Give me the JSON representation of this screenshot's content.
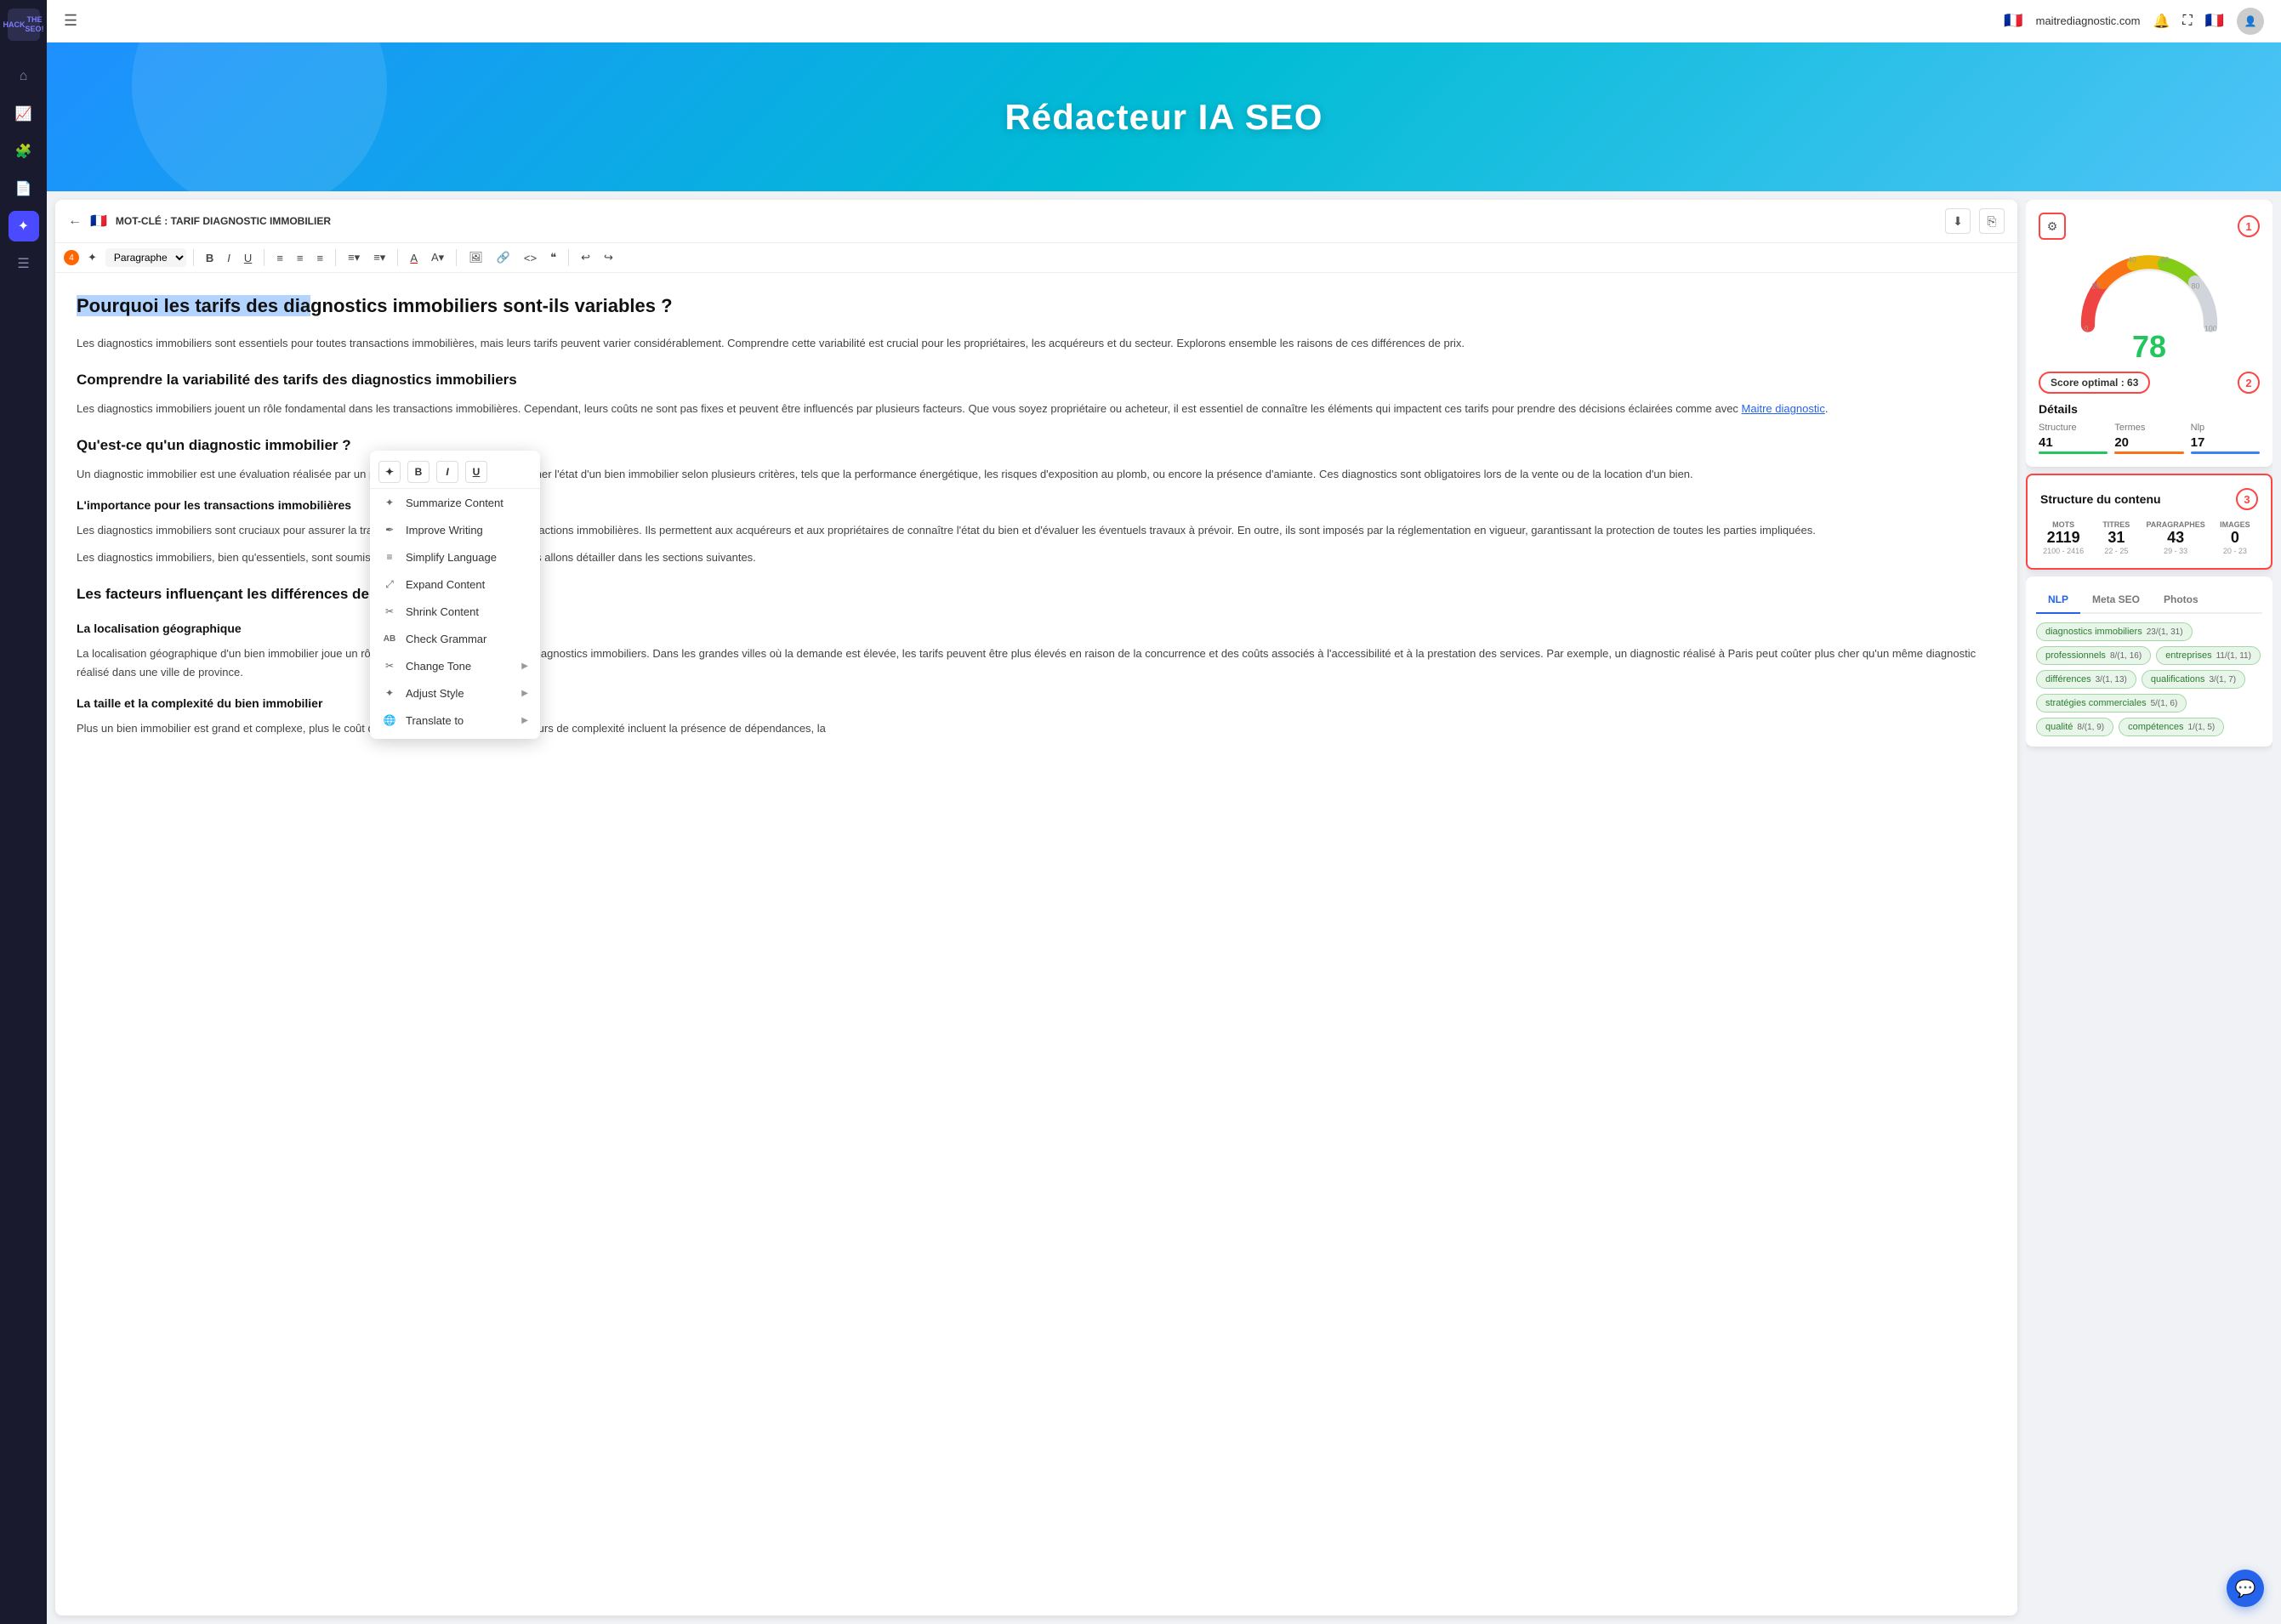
{
  "sidebar": {
    "logo_line1": "HACK",
    "logo_line2": "THE SEO!",
    "items": [
      {
        "name": "home",
        "icon": "⌂",
        "active": false
      },
      {
        "name": "analytics",
        "icon": "📈",
        "active": false
      },
      {
        "name": "puzzle",
        "icon": "🧩",
        "active": false
      },
      {
        "name": "document",
        "icon": "📄",
        "active": false
      },
      {
        "name": "star",
        "icon": "✦",
        "active": true
      },
      {
        "name": "menu2",
        "icon": "☰",
        "active": false
      }
    ]
  },
  "topbar": {
    "hamburger_icon": "☰",
    "flag": "🇫🇷",
    "site": "maitrediagnostic.com",
    "bell_icon": "🔔",
    "expand_icon": "⛶",
    "flag2": "🇫🇷"
  },
  "hero": {
    "title": "Rédacteur IA SEO"
  },
  "editor": {
    "back_icon": "←",
    "keyword_label": "MOT-CLÉ : TARIF DIAGNOSTIC IMMOBILIER",
    "download_icon": "⬇",
    "share_icon": "⎘",
    "toolbar": {
      "magic_icon": "✦",
      "paragraph_label": "Paragraphe",
      "bold": "B",
      "italic": "I",
      "underline": "U",
      "align_left": "≡",
      "align_center": "≡",
      "align_right": "≡",
      "list_ul": "≡",
      "list_ol": "≡",
      "font_color": "A",
      "highlight": "A",
      "image": "🖼",
      "link": "🔗",
      "code": "<>",
      "quote": "❝",
      "undo": "↩",
      "redo": "↪",
      "badge_number": "4"
    },
    "content": {
      "h1": "Pourquoi les tarifs des diagnostics immobiliers sont-ils variables ?",
      "p1": "Les diagnostics immobiliers sont essentiels pour toutes transactions immobilières, mais leurs tarifs peuvent varier considérablement. Comprendre cette variabilité est crucial pour les propriétaires, les acquéreurs et du secteur. Explorons ensemble les raisons de ces différences de prix.",
      "h2_1": "Comprendre la variabilité des tarifs des diagnostics immobiliers",
      "p2": "Les diagnostics immobiliers jouent un rôle fondamental dans les transactions immobilières. Cependant, leurs coûts ne sont pas fixes et peuvent être influencés par plusieurs facteurs. Que vous soyez propriétaire ou acheteur, il est essentiel de connaître les éléments qui impactent ces tarifs pour prendre des décisions éclairées comme avec Maitre diagnostic.",
      "h2_2": "Qu'est-ce qu'un diagnostic immobilier ?",
      "p3": "Un diagnostic immobilier est une évaluation réalisée par un professionnel certifié pour déterminer l'état d'un bien immobilier selon plusieurs critères, tels que la performance énergétique, les risques d'exposition au plomb, ou encore la présence d'amiante. Ces diagnostics sont obligatoires lors de la vente ou de la location d'un bien.",
      "h3_1": "L'importance pour les transactions immobilières",
      "p4": "Les diagnostics immobiliers sont cruciaux pour assurer la transparence et la sécurité des transactions immobilières. Ils permettent aux acquéreurs et aux propriétaires de connaître l'état du bien et d'évaluer les éventuels travaux à prévoir. En outre, ils sont imposés par la réglementation en vigueur, garantissant la protection de toutes les parties impliquées.",
      "p5": "Les diagnostics immobiliers, bien qu'essentiels, sont soumis à une variabilité des prix que nous allons détailler dans les sections suivantes.",
      "h2_3": "Les facteurs influençant les différences de prix",
      "h3_2": "La localisation géographique",
      "p6": "La localisation géographique d'un bien immobilier joue un rôle majeur dans la tarification des diagnostics immobiliers. Dans les grandes villes où la demande est élevée, les tarifs peuvent être plus élevés en raison de la concurrence et des coûts associés à l'accessibilité et à la prestation des services. Par exemple, un diagnostic réalisé à Paris peut coûter plus cher qu'un même diagnostic réalisé dans une ville de province.",
      "h3_3": "La taille et la complexité du bien immobilier",
      "p7": "Plus un bien immobilier est grand et complexe, plus le coût du diagnostic sera élevé. Les facteurs de complexité incluent la présence de dépendances, la",
      "link_text": "Maitre diagnostic"
    }
  },
  "context_menu": {
    "bold": "B",
    "italic": "I",
    "underline": "U",
    "items": [
      {
        "label": "Summarize Content",
        "icon": "✦",
        "has_arrow": false
      },
      {
        "label": "Improve Writing",
        "icon": "✒",
        "has_arrow": false
      },
      {
        "label": "Simplify Language",
        "icon": "≡",
        "has_arrow": false
      },
      {
        "label": "Expand Content",
        "icon": "⤢",
        "has_arrow": false
      },
      {
        "label": "Shrink Content",
        "icon": "✂",
        "has_arrow": false
      },
      {
        "label": "Check Grammar",
        "icon": "AB",
        "has_arrow": false
      },
      {
        "label": "Change Tone",
        "icon": "✂",
        "has_arrow": true
      },
      {
        "label": "Adjust Style",
        "icon": "✦",
        "has_arrow": true
      },
      {
        "label": "Translate to",
        "icon": "🌐",
        "has_arrow": true
      }
    ]
  },
  "right_panel": {
    "settings_step": "1",
    "score_value": "78",
    "optimal_score": "Score optimal : 63",
    "optimal_step": "2",
    "details_title": "Détails",
    "details": [
      {
        "label": "Structure",
        "value": "41",
        "bar_class": "bar-green"
      },
      {
        "label": "Termes",
        "value": "20",
        "bar_class": "bar-orange"
      },
      {
        "label": "Nlp",
        "value": "17",
        "bar_class": "bar-blue"
      }
    ],
    "structure_title": "Structure du contenu",
    "structure_step": "3",
    "stats": [
      {
        "label": "MOTS",
        "value": "2119",
        "range": "2100 - 2416"
      },
      {
        "label": "TITRES",
        "value": "31",
        "range": "22 - 25"
      },
      {
        "label": "PARAGRAPHES",
        "value": "43",
        "range": "29 - 33"
      },
      {
        "label": "IMAGES",
        "value": "0",
        "range": "20 - 23"
      }
    ],
    "tabs": [
      "NLP",
      "Meta SEO",
      "Photos"
    ],
    "active_tab": "NLP",
    "keywords": [
      {
        "text": "diagnostics immobiliers",
        "count": "23/(1, 31)"
      },
      {
        "text": "professionnels",
        "count": "8/(1, 16)"
      },
      {
        "text": "entreprises",
        "count": "11/(1, 11)"
      },
      {
        "text": "différences",
        "count": "3/(1, 13)"
      },
      {
        "text": "qualifications",
        "count": "3/(1, 7)"
      },
      {
        "text": "stratégies commerciales",
        "count": "5/(1, 6)"
      },
      {
        "text": "qualité",
        "count": "8/(1, 9)"
      },
      {
        "text": "compétences",
        "count": "1/(1, 5)"
      }
    ]
  },
  "chat_btn": "💬"
}
